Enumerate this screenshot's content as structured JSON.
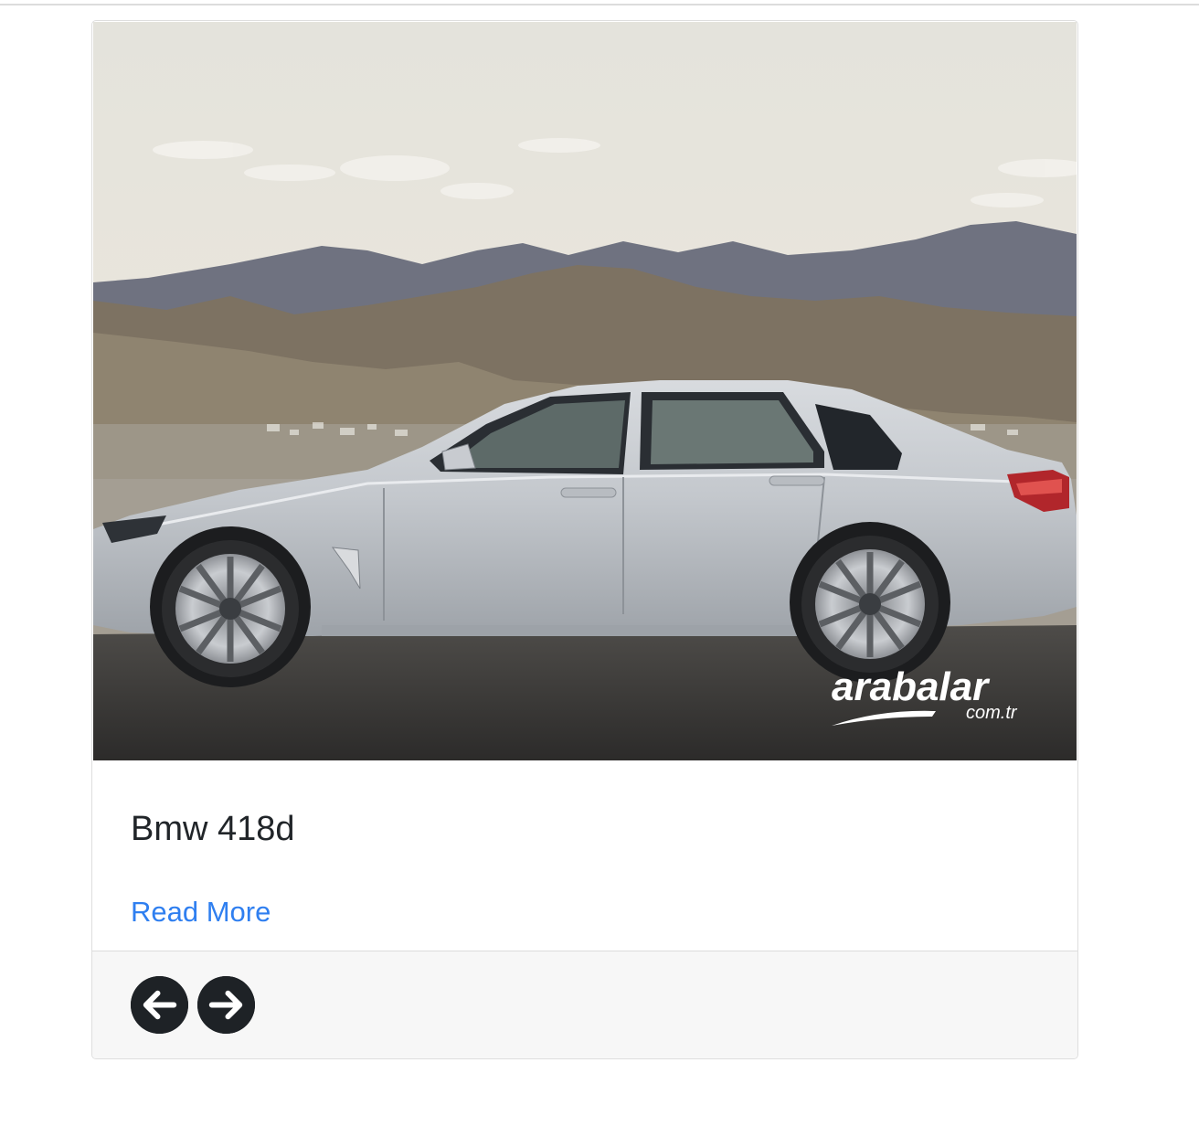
{
  "card": {
    "title": "Bmw 418d",
    "link_label": "Read More",
    "image": {
      "subject": "silver BMW 4 Series Gran Coupe in front of mountains",
      "watermark_main": "arabalar",
      "watermark_sub": "com.tr"
    }
  },
  "footer": {
    "prev_icon": "arrow-left-circle-icon",
    "next_icon": "arrow-right-circle-icon"
  },
  "colors": {
    "link": "#2f7ff0",
    "button": "#1e2226",
    "footer_bg": "#f7f7f7",
    "border": "#dedede"
  }
}
